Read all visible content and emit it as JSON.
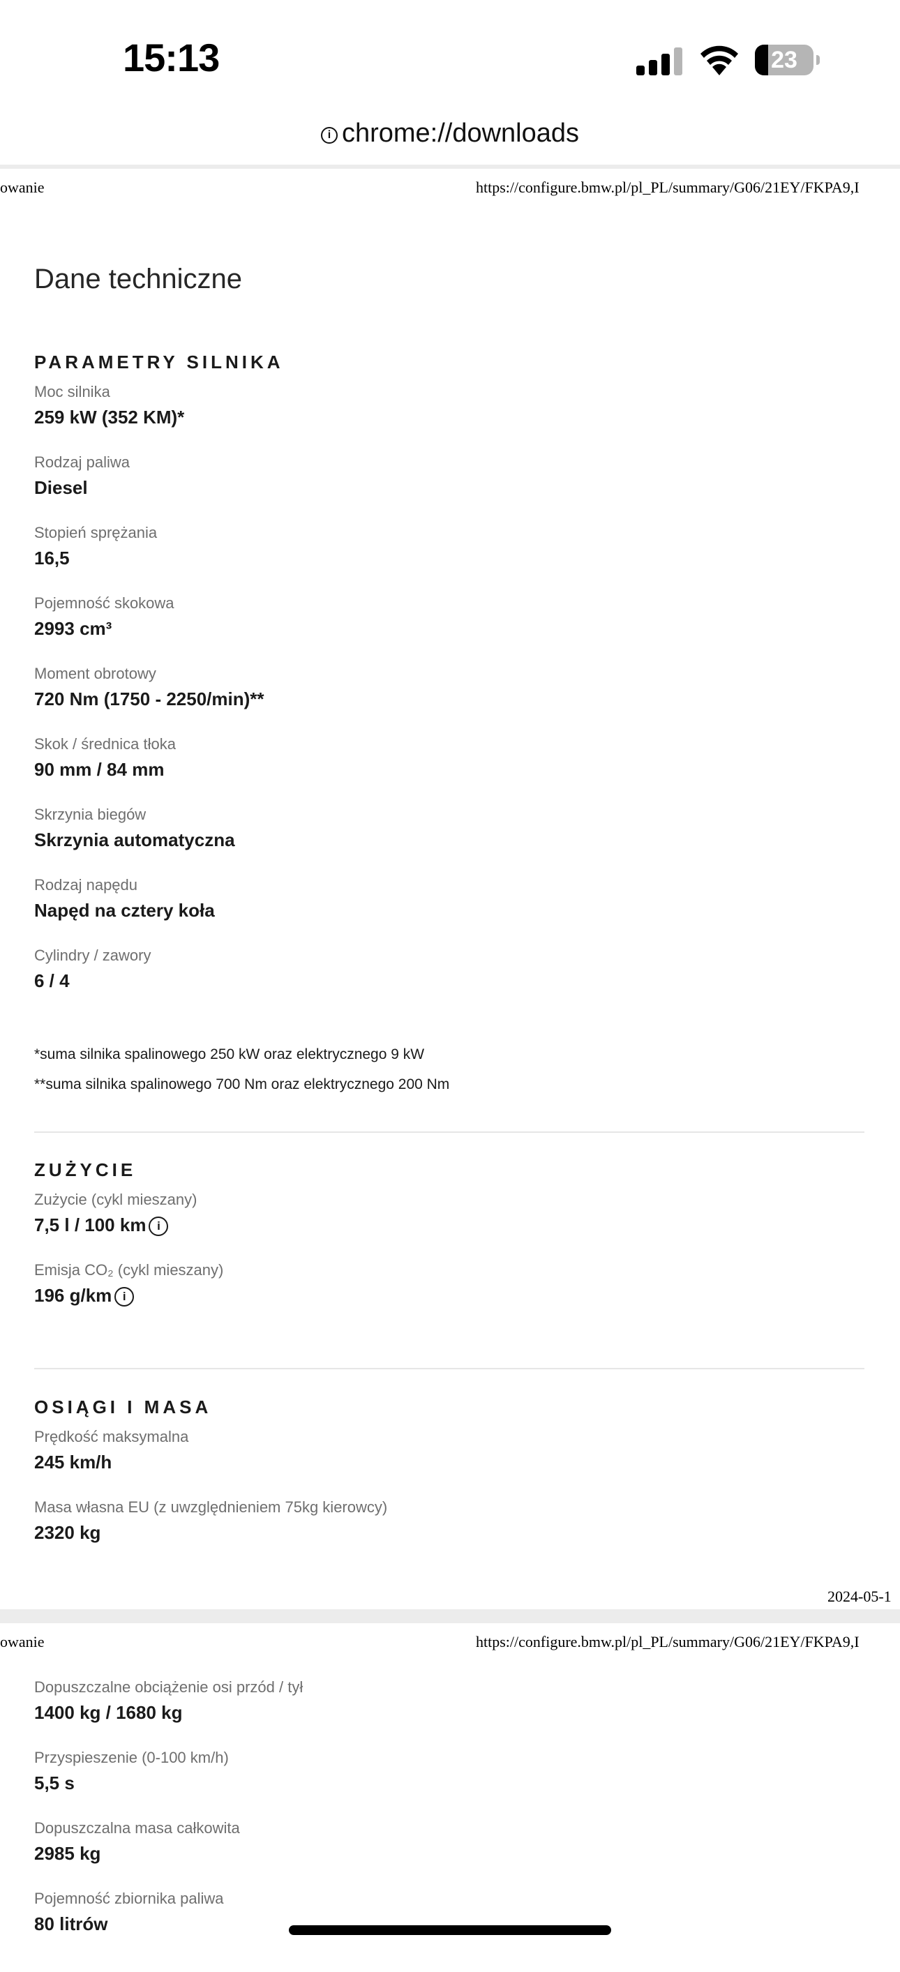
{
  "status_bar": {
    "time": "15:13",
    "battery_level": "23",
    "icons": [
      "signal-icon",
      "wifi-icon",
      "battery-icon"
    ]
  },
  "url_bar": {
    "url": "chrome://downloads",
    "icon": "info-icon"
  },
  "page1": {
    "header_left": "owanie",
    "header_right": "https://configure.bmw.pl/pl_PL/summary/G06/21EY/FKPA9,I",
    "footer_right": "2024-05-1",
    "title": "Dane techniczne",
    "engine": {
      "heading": "PARAMETRY SILNIKA",
      "items": [
        {
          "label": "Moc silnika",
          "value": "259 kW (352 KM)*"
        },
        {
          "label": "Rodzaj paliwa",
          "value": "Diesel"
        },
        {
          "label": "Stopień sprężania",
          "value": "16,5"
        },
        {
          "label": "Pojemność skokowa",
          "value": "2993 cm³"
        },
        {
          "label": "Moment obrotowy",
          "value": "720 Nm (1750 - 2250/min)**"
        },
        {
          "label": "Skok / średnica tłoka",
          "value": "90 mm / 84 mm"
        },
        {
          "label": "Skrzynia biegów",
          "value": "Skrzynia automatyczna"
        },
        {
          "label": "Rodzaj napędu",
          "value": "Napęd na cztery koła"
        },
        {
          "label": "Cylindry / zawory",
          "value": "6 / 4"
        }
      ],
      "footnotes": [
        "*suma silnika spalinowego 250 kW oraz elektrycznego 9 kW",
        "**suma silnika spalinowego 700 Nm oraz elektrycznego 200 Nm"
      ]
    },
    "consumption": {
      "heading": "ZUŻYCIE",
      "items": [
        {
          "label": "Zużycie (cykl mieszany)",
          "value": "7,5 l / 100 km",
          "info_icon": "i"
        },
        {
          "label": "Emisja CO₂ (cykl mieszany)",
          "value": "196 g/km",
          "info_icon": "i"
        }
      ]
    },
    "performance": {
      "heading": "OSIĄGI I MASA",
      "items": [
        {
          "label": "Prędkość maksymalna",
          "value": "245 km/h"
        },
        {
          "label": "Masa własna EU (z uwzględnieniem 75kg kierowcy)",
          "value": "2320 kg"
        }
      ]
    }
  },
  "page2": {
    "header_left": "owanie",
    "header_right": "https://configure.bmw.pl/pl_PL/summary/G06/21EY/FKPA9,I",
    "items": [
      {
        "label": "Dopuszczalne obciążenie osi przód / tył",
        "value": "1400 kg / 1680 kg"
      },
      {
        "label": "Przyspieszenie (0-100 km/h)",
        "value": "5,5 s"
      },
      {
        "label": "Dopuszczalna masa całkowita",
        "value": "2985 kg"
      },
      {
        "label": "Pojemność zbiornika paliwa",
        "value": "80 litrów"
      }
    ]
  }
}
